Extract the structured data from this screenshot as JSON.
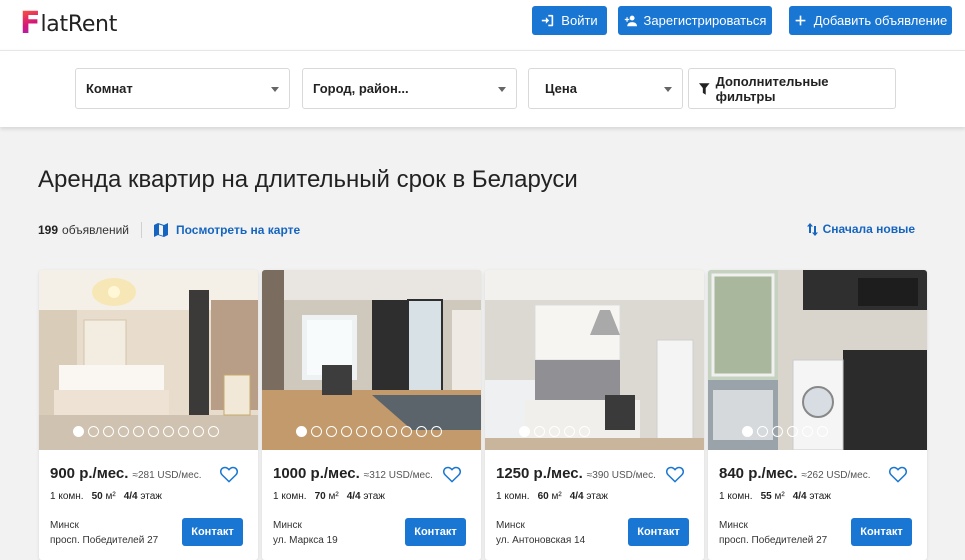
{
  "logo": {
    "letter": "F",
    "rest": "latRent"
  },
  "header": {
    "login_label": "Войти",
    "register_label": "Зарегистрироваться",
    "add_listing_label": "Добавить объявление"
  },
  "filters": {
    "rooms": "Комнат",
    "city": "Город, район...",
    "price": "Цена",
    "more": "Дополнительные фильтры"
  },
  "page_title": "Аренда квартир на длительный срок в Беларуси",
  "listing_info": {
    "count": "199",
    "count_label": "объявлений",
    "map_link": "Посмотреть на карте",
    "sort": "Сначала новые"
  },
  "colors": {
    "accent": "#1976d2",
    "link": "#1565c0"
  },
  "cards": [
    {
      "price": "900 р./мес.",
      "usd": "≈281 USD/мес.",
      "rooms": "1 комн.",
      "area_num": "50",
      "area_unit": "м²",
      "floor": "4/4",
      "floor_label": "этаж",
      "city": "Минск",
      "address": "просп. Победителей 27",
      "photo_count": 10,
      "photo_active": 1,
      "contact": "Контакт"
    },
    {
      "price": "1000 р./мес.",
      "usd": "≈312 USD/мес.",
      "rooms": "1 комн.",
      "area_num": "70",
      "area_unit": "м²",
      "floor": "4/4",
      "floor_label": "этаж",
      "city": "Минск",
      "address": "ул. Маркса 19",
      "photo_count": 10,
      "photo_active": 1,
      "contact": "Контакт"
    },
    {
      "price": "1250 р./мес.",
      "usd": "≈390 USD/мес.",
      "rooms": "1 комн.",
      "area_num": "60",
      "area_unit": "м²",
      "floor": "4/4",
      "floor_label": "этаж",
      "city": "Минск",
      "address": "ул. Антоновская 14",
      "photo_count": 5,
      "photo_active": 1,
      "contact": "Контакт"
    },
    {
      "price": "840 р./мес.",
      "usd": "≈262 USD/мес.",
      "rooms": "1 комн.",
      "area_num": "55",
      "area_unit": "м²",
      "floor": "4/4",
      "floor_label": "этаж",
      "city": "Минск",
      "address": "просп. Победителей 27",
      "photo_count": 6,
      "photo_active": 1,
      "contact": "Контакт"
    }
  ]
}
